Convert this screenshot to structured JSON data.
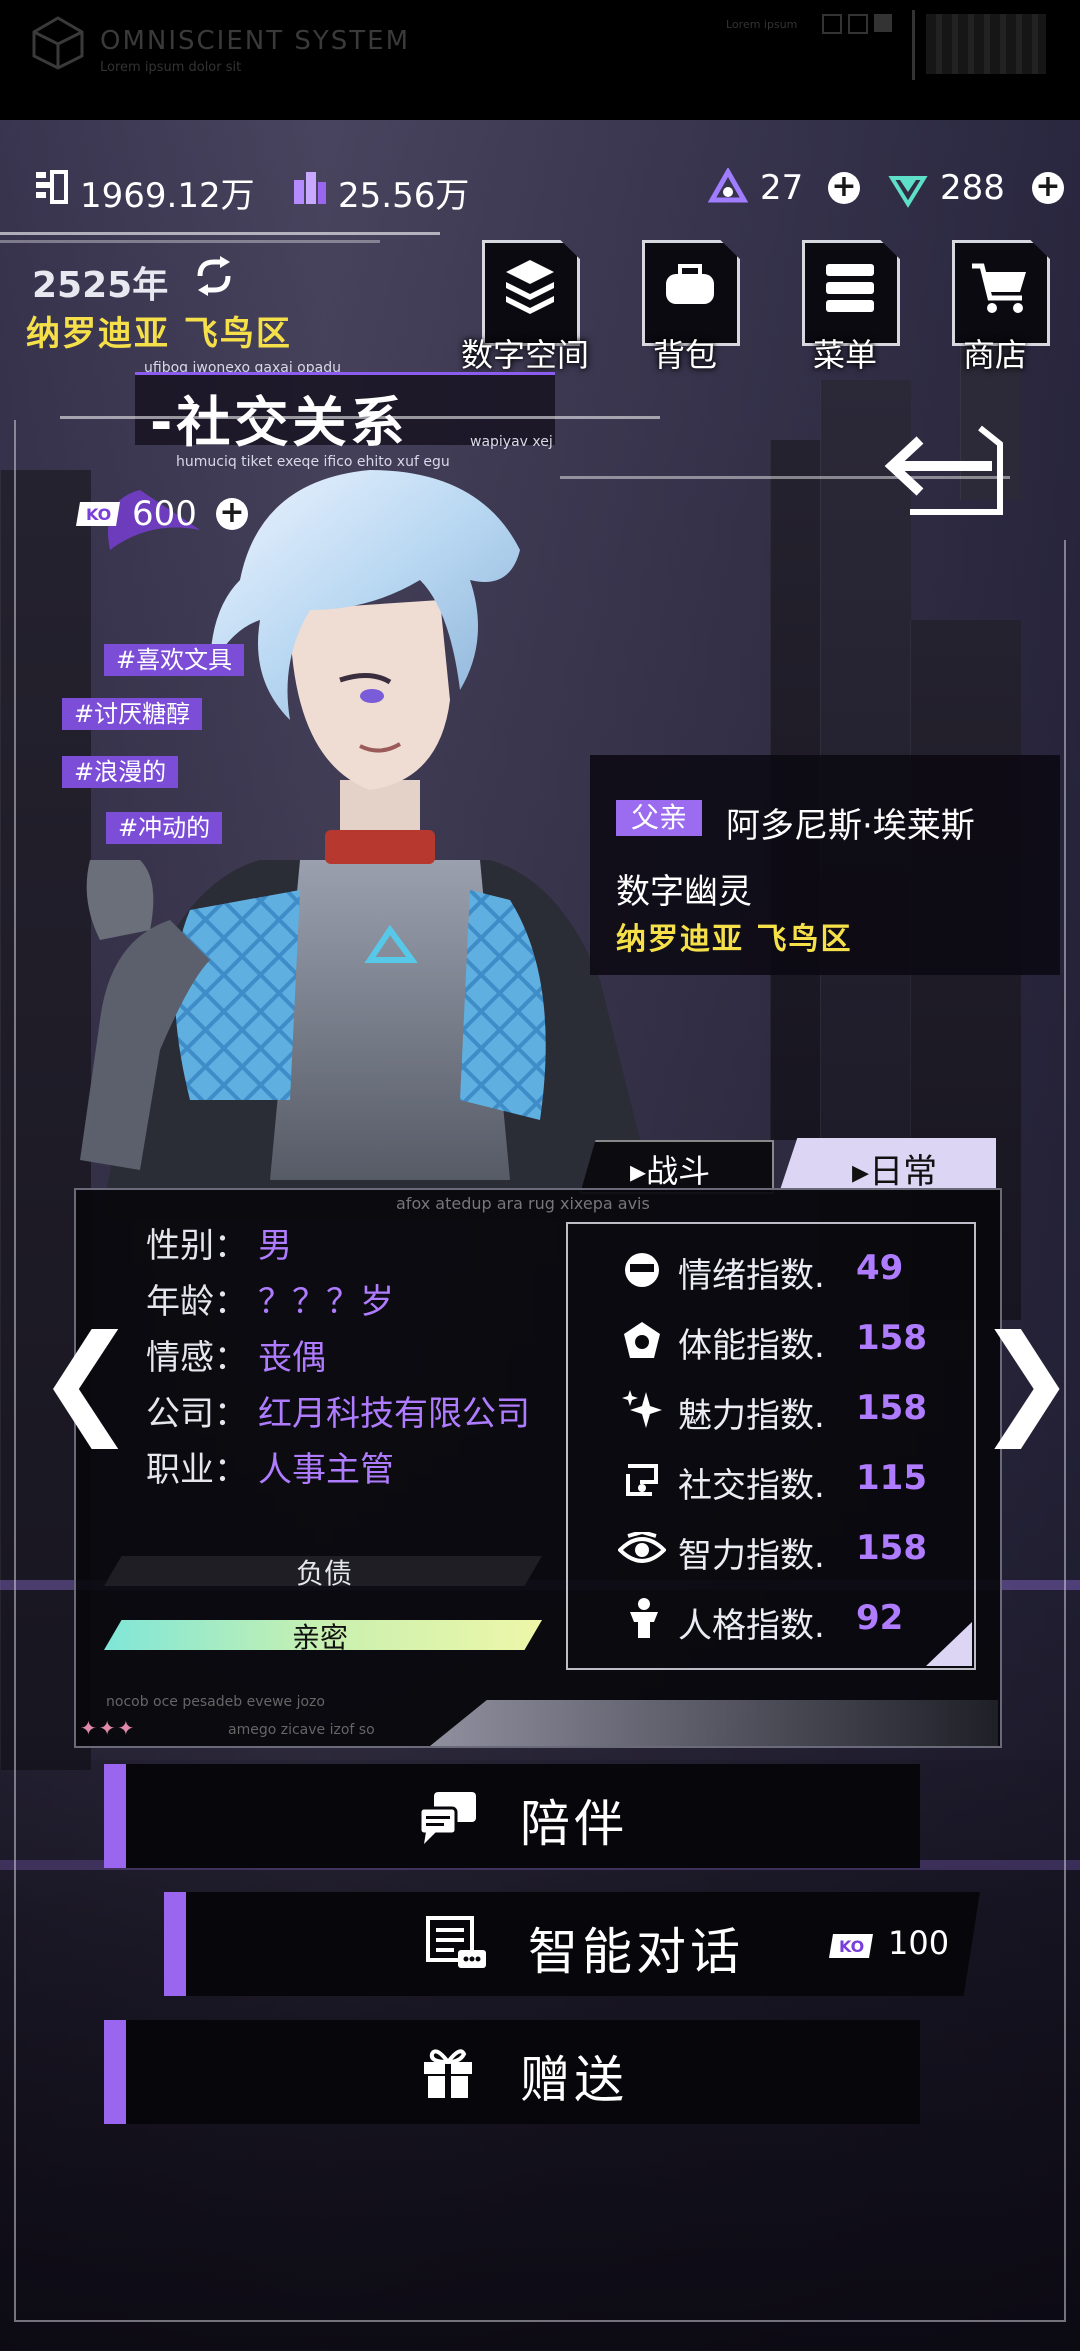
{
  "system": {
    "title": "OMNISCIENT SYSTEM",
    "subtitle": "Lorem ipsum dolor sit",
    "corner_text": "Lorem ipsum"
  },
  "currencies": {
    "money": "1969.12万",
    "crystals": "25.56万",
    "tokens": "27",
    "gems": "288"
  },
  "location": {
    "year": "2525年",
    "place": "纳罗迪亚 飞鸟区"
  },
  "menu": [
    {
      "label": "数字空间",
      "icon": "layers-icon"
    },
    {
      "label": "背包",
      "icon": "backpack-icon"
    },
    {
      "label": "菜单",
      "icon": "menu-list-icon"
    },
    {
      "label": "商店",
      "icon": "cart-icon"
    }
  ],
  "section": {
    "title": "-社交关系",
    "caption_top": "ufibog iwonexo gaxaj opadu",
    "caption_right": "wapiyav xej",
    "caption_bottom": "humuciq tiket exeqe ifico ehito xuf egu"
  },
  "coins": "600",
  "tags": [
    "#喜欢文具",
    "#讨厌糖醇",
    "#浪漫的",
    "#冲动的"
  ],
  "relation": {
    "badge": "父亲",
    "name": "阿多尼斯·埃莱斯",
    "type": "数字幽灵",
    "place": "纳罗迪亚 飞鸟区"
  },
  "tabs": {
    "battle": "战斗",
    "daily": "日常"
  },
  "panel_caption": "afox atedup ara rug xixepa avis",
  "profile": [
    {
      "label": "性别：",
      "value": "男"
    },
    {
      "label": "年龄：",
      "value": "？？？岁"
    },
    {
      "label": "情感：",
      "value": "丧偶"
    },
    {
      "label": "公司：",
      "value": "红月科技有限公司"
    },
    {
      "label": "职业：",
      "value": "人事主管"
    }
  ],
  "bars": {
    "debt_label": "负债",
    "debt_fill": 0,
    "intimacy_label": "亲密",
    "intimacy_fill": 1.0
  },
  "stats": [
    {
      "label": "情绪指数.",
      "value": "49",
      "icon": "mood-icon"
    },
    {
      "label": "体能指数.",
      "value": "158",
      "icon": "stamina-icon"
    },
    {
      "label": "魅力指数.",
      "value": "158",
      "icon": "sparkle-icon"
    },
    {
      "label": "社交指数.",
      "value": "115",
      "icon": "social-icon"
    },
    {
      "label": "智力指数.",
      "value": "158",
      "icon": "eye-icon"
    },
    {
      "label": "人格指数.",
      "value": "92",
      "icon": "person-icon"
    }
  ],
  "panel_footer": {
    "left": "nocob oce pesadeb evewe jozo",
    "right": "amego zicave izof so"
  },
  "actions": {
    "accompany": "陪伴",
    "chat": "智能对话",
    "chat_cost": "100",
    "gift": "赠送"
  },
  "colors": {
    "accent": "#9a66f0",
    "value_purple": "#b07cff",
    "location_yellow": "#f5e04a"
  }
}
